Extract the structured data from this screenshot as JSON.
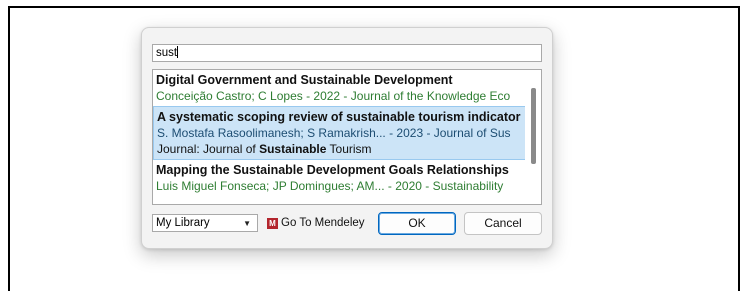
{
  "search": {
    "value": "sust"
  },
  "results": [
    {
      "title": "Digital Government and Sustainable Development",
      "meta": "Conceição Castro; C Lopes - 2022 - Journal of the Knowledge Eco",
      "selected": false
    },
    {
      "title": "A systematic scoping review of sustainable tourism indicator",
      "meta": "S. Mostafa Rasoolimanesh; S Ramakrish... - 2023 - Journal of Sus",
      "journal_prefix": "Journal: Journal of ",
      "journal_bold": "Sustainable",
      "journal_suffix": " Tourism",
      "selected": true
    },
    {
      "title": "Mapping the Sustainable Development Goals Relationships",
      "meta": "Luis Miguel Fonseca; JP Domingues; AM... - 2020 - Sustainability",
      "selected": false
    }
  ],
  "library_select": {
    "value": "My Library"
  },
  "mendeley": {
    "label": "Go To Mendeley",
    "logo": "M"
  },
  "buttons": {
    "ok": "OK",
    "cancel": "Cancel"
  }
}
